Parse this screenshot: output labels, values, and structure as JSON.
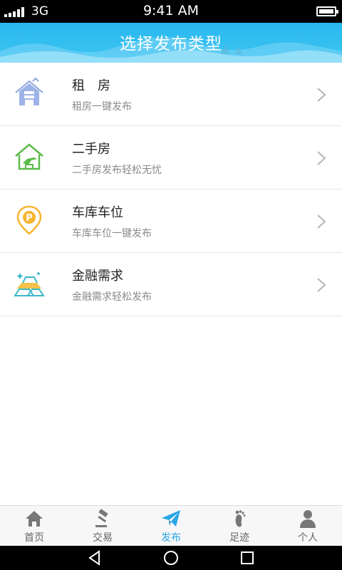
{
  "status_bar": {
    "network": "3G",
    "time": "9:41 AM"
  },
  "header": {
    "title": "选择发布类型"
  },
  "items": [
    {
      "title": "租　房",
      "subtitle": "租房一键发布",
      "icon": "house-icon"
    },
    {
      "title": "二手房",
      "subtitle": "二手房发布轻松无忧",
      "icon": "second-hand-house-icon"
    },
    {
      "title": "车库车位",
      "subtitle": "车库车位一键发布",
      "icon": "parking-pin-icon"
    },
    {
      "title": "金融需求",
      "subtitle": "金融需求轻松发布",
      "icon": "gold-bar-icon"
    }
  ],
  "bottom_nav": [
    {
      "label": "首页",
      "icon": "home-icon"
    },
    {
      "label": "交易",
      "icon": "gavel-icon"
    },
    {
      "label": "发布",
      "icon": "paper-plane-icon",
      "active": true
    },
    {
      "label": "足迹",
      "icon": "footprint-icon"
    },
    {
      "label": "个人",
      "icon": "person-icon"
    }
  ],
  "colors": {
    "accent": "#2aa6e6",
    "header": "#29b7ee"
  }
}
